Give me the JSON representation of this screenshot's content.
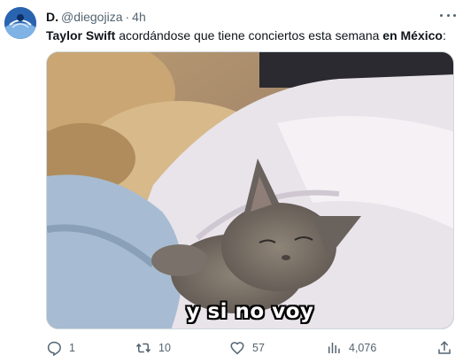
{
  "author": {
    "display_name": "D.",
    "handle": "@diegojiza",
    "separator": "·",
    "time": "4h"
  },
  "tweet": {
    "text_parts": {
      "p1_bold": "Taylor Swift",
      "p2": " acordándose que tiene conciertos esta semana ",
      "p3_bold": "en México",
      "p4": ":"
    },
    "image_caption": "y si no voy"
  },
  "actions": {
    "replies": "1",
    "retweets": "10",
    "likes": "57",
    "views": "4,076"
  },
  "icons": {
    "more": "more-horizontal-icon",
    "reply": "reply-icon",
    "retweet": "retweet-icon",
    "like": "heart-icon",
    "views": "views-chart-icon",
    "share": "share-icon"
  },
  "colors": {
    "text_primary": "#0f1419",
    "text_secondary": "#536471",
    "border": "#cfd9de"
  }
}
